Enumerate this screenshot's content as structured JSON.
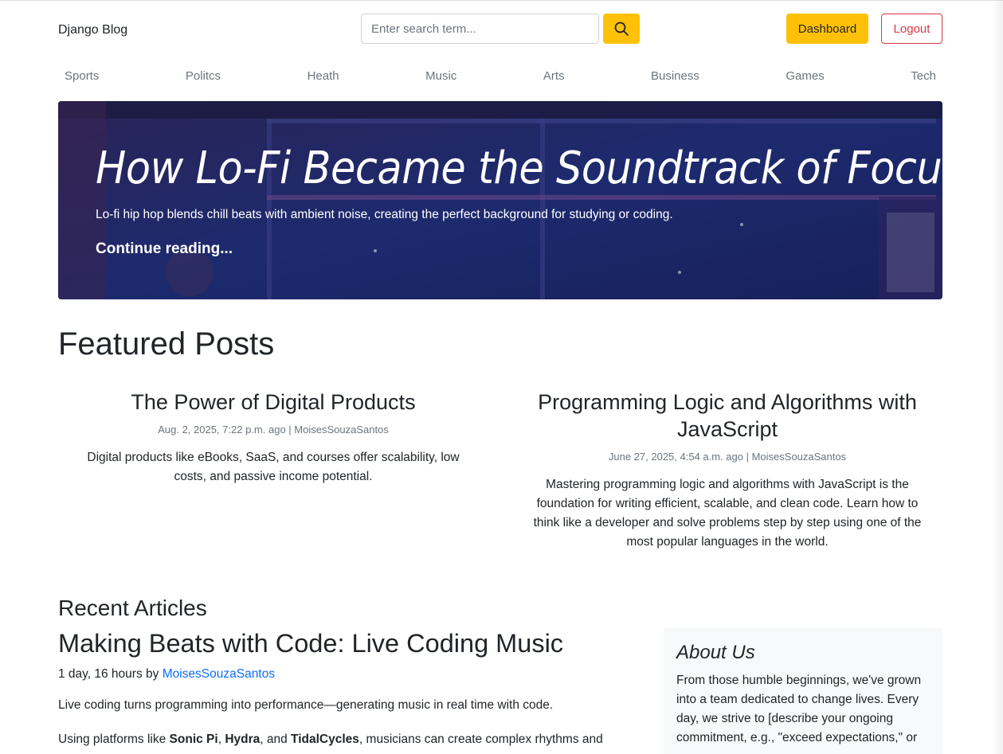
{
  "header": {
    "brand": "Django Blog",
    "search_placeholder": "Enter search term...",
    "dashboard_label": "Dashboard",
    "logout_label": "Logout"
  },
  "nav": {
    "items": [
      "Sports",
      "Politcs",
      "Heath",
      "Music",
      "Arts",
      "Business",
      "Games",
      "Tech"
    ]
  },
  "hero": {
    "title": "How Lo-Fi Became the Soundtrack of Focus",
    "subtitle": "Lo-fi hip hop blends chill beats with ambient noise, creating the perfect background for studying or coding.",
    "link": "Continue reading..."
  },
  "featured": {
    "heading": "Featured Posts",
    "posts": [
      {
        "title": "The Power of Digital Products",
        "meta": "Aug. 2, 2025, 7:22 p.m. ago | MoisesSouzaSantos",
        "desc": "Digital products like eBooks, SaaS, and courses offer scalability, low costs, and passive income potential."
      },
      {
        "title": "Programming Logic and Algorithms with JavaScript",
        "meta": "June 27, 2025, 4:54 a.m. ago | MoisesSouzaSantos",
        "desc": "Mastering programming logic and algorithms with JavaScript is the foundation for writing efficient, scalable, and clean code. Learn how to think like a developer and solve problems step by step using one of the most popular languages in the world."
      }
    ]
  },
  "recent": {
    "heading": "Recent Articles",
    "article": {
      "title": "Making Beats with Code: Live Coding Music",
      "meta_prefix": "1 day, 16 hours by ",
      "author": "MoisesSouzaSantos",
      "p1": "Live coding turns programming into performance—generating music in real time with code.",
      "p2_a": "Using platforms like ",
      "p2_b1": "Sonic Pi",
      "p2_sep1": ", ",
      "p2_b2": "Hydra",
      "p2_sep2": ", and ",
      "p2_b3": "TidalCycles",
      "p2_c": ", musicians can create complex rhythms and"
    }
  },
  "about": {
    "heading": "About Us",
    "text": "From those humble beginnings, we've grown into a team dedicated to change lives. Every day, we strive to [describe your ongoing commitment, e.g., \"exceed expectations,\" or"
  },
  "colors": {
    "accent": "#ffc107",
    "danger": "#dc3545",
    "link": "#0d6efd",
    "muted": "#6c757d"
  }
}
